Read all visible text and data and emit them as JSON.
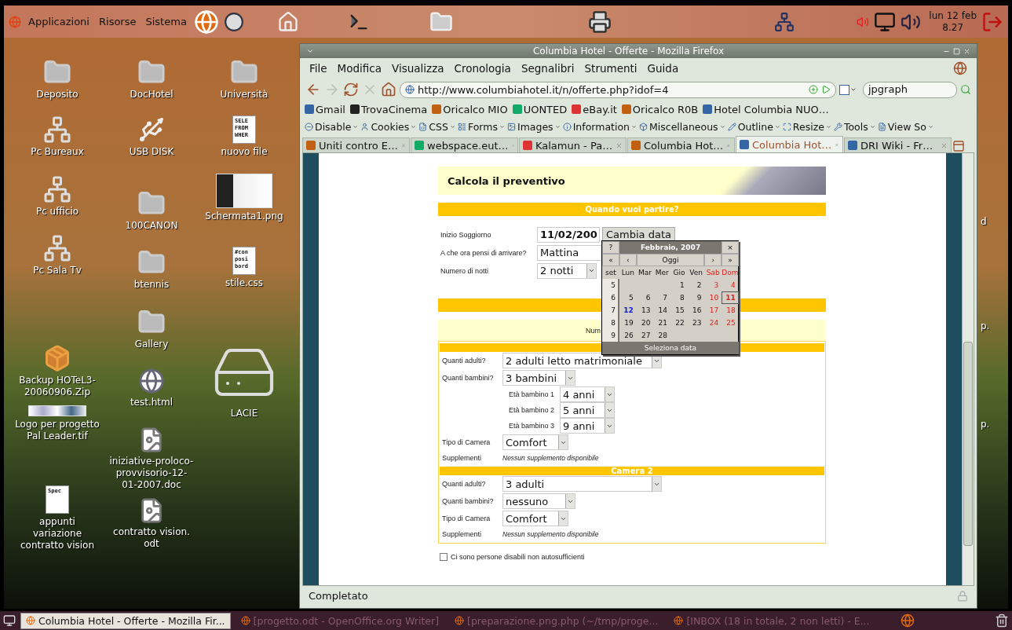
{
  "top_panel": {
    "menus": [
      "Applicazioni",
      "Risorse",
      "Sistema"
    ],
    "clock": {
      "date": "lun 12 feb",
      "time": "8.27"
    }
  },
  "desktop_icons": [
    {
      "label": "Deposito",
      "kind": "folder-link"
    },
    {
      "label": "Pc Bureaux",
      "kind": "network-folder"
    },
    {
      "label": "Pc ufficio",
      "kind": "network-folder"
    },
    {
      "label": "Pc Sala Tv",
      "kind": "network-folder"
    },
    {
      "label": "Backup HOTeL3-20060906.Zip",
      "kind": "archive"
    },
    {
      "label": "Logo per progetto Pal Leader.tif",
      "kind": "image-strip"
    },
    {
      "label": "appunti variazione contratto vision",
      "kind": "text-file",
      "preview": "Spec"
    },
    {
      "label": "DocHotel",
      "kind": "folder-link"
    },
    {
      "label": "USB DISK",
      "kind": "usb"
    },
    {
      "label": "100CANON",
      "kind": "folder"
    },
    {
      "label": "btennis",
      "kind": "folder"
    },
    {
      "label": "Gallery",
      "kind": "folder"
    },
    {
      "label": "test.html",
      "kind": "web-file"
    },
    {
      "label": "iniziative-proloco-provvisorio-12-01-2007.doc",
      "kind": "doc-file"
    },
    {
      "label": "contratto vision. odt",
      "kind": "doc-file"
    },
    {
      "label": "Università",
      "kind": "folder-link"
    },
    {
      "label": "nuovo file",
      "kind": "text-file",
      "preview": "SELE FROM WHER"
    },
    {
      "label": "Schermata1.png",
      "kind": "screenshot"
    },
    {
      "label": "stile.css",
      "kind": "text-file",
      "preview": "#con posi bord"
    },
    {
      "label": "LACIE",
      "kind": "drive"
    }
  ],
  "desktop_cut_labels": [
    "d",
    "p.",
    "p."
  ],
  "browser": {
    "title": "Columbia Hotel - Offerte - Mozilla Firefox",
    "menu": [
      "File",
      "Modifica",
      "Visualizza",
      "Cronologia",
      "Segnalibri",
      "Strumenti",
      "Guida"
    ],
    "url": "http://www.columbiahotel.it/n/offerte.php?idof=4",
    "search": "jpgraph",
    "bookmarks": [
      "Gmail",
      "TrovaCinema",
      "Oricalco MIO",
      "UONTED",
      "eBay.it",
      "Oricalco R0B",
      "Hotel Columbia NUO…"
    ],
    "devtools": [
      "Disable",
      "Cookies",
      "CSS",
      "Forms",
      "Images",
      "Information",
      "Miscellaneous",
      "Outline",
      "Resize",
      "Tools",
      "View So"
    ],
    "tabs": [
      {
        "label": "Uniti contro E…",
        "selected": false
      },
      {
        "label": "webspace.eut…",
        "selected": false
      },
      {
        "label": "Kalamun - Pa…",
        "selected": false
      },
      {
        "label": "Columbia Hot…",
        "selected": false
      },
      {
        "label": "Columbia Hot…",
        "selected": true
      },
      {
        "label": "DRI Wiki - Fr…",
        "selected": false
      }
    ],
    "status": "Completato"
  },
  "page": {
    "heading": "Calcola il preventivo",
    "section_title": "Quando vuoi partire?",
    "stay_fields": [
      {
        "label": "Inizio Soggiorno",
        "kind": "date",
        "value": "11/02/200",
        "button": "Cambia data"
      },
      {
        "label": "A che ora pensi di arrivare?",
        "kind": "text",
        "value": "Mattina"
      },
      {
        "label": "Numero di notti",
        "kind": "select",
        "value": "2 notti"
      }
    ],
    "rooms_note": "Num",
    "rooms": [
      {
        "fields": [
          {
            "label": "Quanti adulti?",
            "kind": "wide-select",
            "value": "2 adulti letto matrimoniale"
          },
          {
            "label": "Quanti bambini?",
            "kind": "select",
            "value": "3 bambini"
          },
          {
            "label": "Età bambino 1",
            "kind": "child-select",
            "value": "4 anni"
          },
          {
            "label": "Età bambino 2",
            "kind": "child-select",
            "value": "5 anni"
          },
          {
            "label": "Età bambino 3",
            "kind": "child-select",
            "value": "9 anni"
          },
          {
            "label": "Tipo di Camera",
            "kind": "short-select",
            "value": "Comfort"
          },
          {
            "label": "Supplementi",
            "kind": "note",
            "value": "Nessun supplemento disponibile"
          }
        ]
      },
      {
        "title": "Camera 2",
        "fields": [
          {
            "label": "Quanti adulti?",
            "kind": "wide-select",
            "value": "3 adulti"
          },
          {
            "label": "Quanti bambini?",
            "kind": "select",
            "value": "nessuno"
          },
          {
            "label": "Tipo di Camera",
            "kind": "short-select",
            "value": "Comfort"
          },
          {
            "label": "Supplementi",
            "kind": "note",
            "value": "Nessun supplemento disponibile"
          }
        ]
      }
    ],
    "disabled_check": {
      "label": "Ci sono persone disabili non autosufficienti",
      "checked": false
    }
  },
  "calendar": {
    "help": "?",
    "title": "Febbraio, 2007",
    "close": "×",
    "nav": [
      "«",
      "‹",
      "Oggi",
      "›",
      "»"
    ],
    "week_header": "set",
    "weekdays": [
      {
        "label": "Lun",
        "weekend": false
      },
      {
        "label": "Mar",
        "weekend": false
      },
      {
        "label": "Mer",
        "weekend": false
      },
      {
        "label": "Gio",
        "weekend": false
      },
      {
        "label": "Ven",
        "weekend": false
      },
      {
        "label": "Sab",
        "weekend": true
      },
      {
        "label": "Dom",
        "weekend": true
      }
    ],
    "weeks": [
      {
        "week": "5",
        "days": [
          {
            "kind": "blank"
          },
          {
            "kind": "blank"
          },
          {
            "kind": "blank"
          },
          {
            "kind": "day",
            "label": "1",
            "weekend": false,
            "today": false,
            "selected": false
          },
          {
            "kind": "day",
            "label": "2",
            "weekend": false,
            "today": false,
            "selected": false
          },
          {
            "kind": "day",
            "label": "3",
            "weekend": true,
            "today": false,
            "selected": false
          },
          {
            "kind": "day",
            "label": "4",
            "weekend": true,
            "today": false,
            "selected": false
          }
        ]
      },
      {
        "week": "6",
        "days": [
          {
            "kind": "day",
            "label": "5",
            "weekend": false,
            "today": false,
            "selected": false
          },
          {
            "kind": "day",
            "label": "6",
            "weekend": false,
            "today": false,
            "selected": false
          },
          {
            "kind": "day",
            "label": "7",
            "weekend": false,
            "today": false,
            "selected": false
          },
          {
            "kind": "day",
            "label": "8",
            "weekend": false,
            "today": false,
            "selected": false
          },
          {
            "kind": "day",
            "label": "9",
            "weekend": false,
            "today": false,
            "selected": false
          },
          {
            "kind": "day",
            "label": "10",
            "weekend": true,
            "today": false,
            "selected": false
          },
          {
            "kind": "day",
            "label": "11",
            "weekend": true,
            "today": false,
            "selected": true
          }
        ]
      },
      {
        "week": "7",
        "days": [
          {
            "kind": "day",
            "label": "12",
            "weekend": false,
            "today": true,
            "selected": false
          },
          {
            "kind": "day",
            "label": "13",
            "weekend": false,
            "today": false,
            "selected": false
          },
          {
            "kind": "day",
            "label": "14",
            "weekend": false,
            "today": false,
            "selected": false
          },
          {
            "kind": "day",
            "label": "15",
            "weekend": false,
            "today": false,
            "selected": false
          },
          {
            "kind": "day",
            "label": "16",
            "weekend": false,
            "today": false,
            "selected": false
          },
          {
            "kind": "day",
            "label": "17",
            "weekend": true,
            "today": false,
            "selected": false
          },
          {
            "kind": "day",
            "label": "18",
            "weekend": true,
            "today": false,
            "selected": false
          }
        ]
      },
      {
        "week": "8",
        "days": [
          {
            "kind": "day",
            "label": "19",
            "weekend": false,
            "today": false,
            "selected": false
          },
          {
            "kind": "day",
            "label": "20",
            "weekend": false,
            "today": false,
            "selected": false
          },
          {
            "kind": "day",
            "label": "21",
            "weekend": false,
            "today": false,
            "selected": false
          },
          {
            "kind": "day",
            "label": "22",
            "weekend": false,
            "today": false,
            "selected": false
          },
          {
            "kind": "day",
            "label": "23",
            "weekend": false,
            "today": false,
            "selected": false
          },
          {
            "kind": "day",
            "label": "24",
            "weekend": true,
            "today": false,
            "selected": false
          },
          {
            "kind": "day",
            "label": "25",
            "weekend": true,
            "today": false,
            "selected": false
          }
        ]
      },
      {
        "week": "9",
        "days": [
          {
            "kind": "day",
            "label": "26",
            "weekend": false,
            "today": false,
            "selected": false
          },
          {
            "kind": "day",
            "label": "27",
            "weekend": false,
            "today": false,
            "selected": false
          },
          {
            "kind": "day",
            "label": "28",
            "weekend": false,
            "today": false,
            "selected": false
          },
          {
            "kind": "blank"
          },
          {
            "kind": "blank"
          },
          {
            "kind": "blank"
          },
          {
            "kind": "blank"
          }
        ]
      }
    ],
    "footer": "Seleziona data"
  },
  "taskbar": {
    "items": [
      {
        "label": "Columbia Hotel - Offerte - Mozilla Fir...",
        "selected": true
      },
      {
        "label": "[progetto.odt - OpenOffice.org Writer]",
        "selected": false
      },
      {
        "label": "[preparazione.png.php (~/tmp/proge...",
        "selected": false
      },
      {
        "label": "[INBOX (18 in totale, 2 non letti) - E...",
        "selected": false
      }
    ]
  }
}
